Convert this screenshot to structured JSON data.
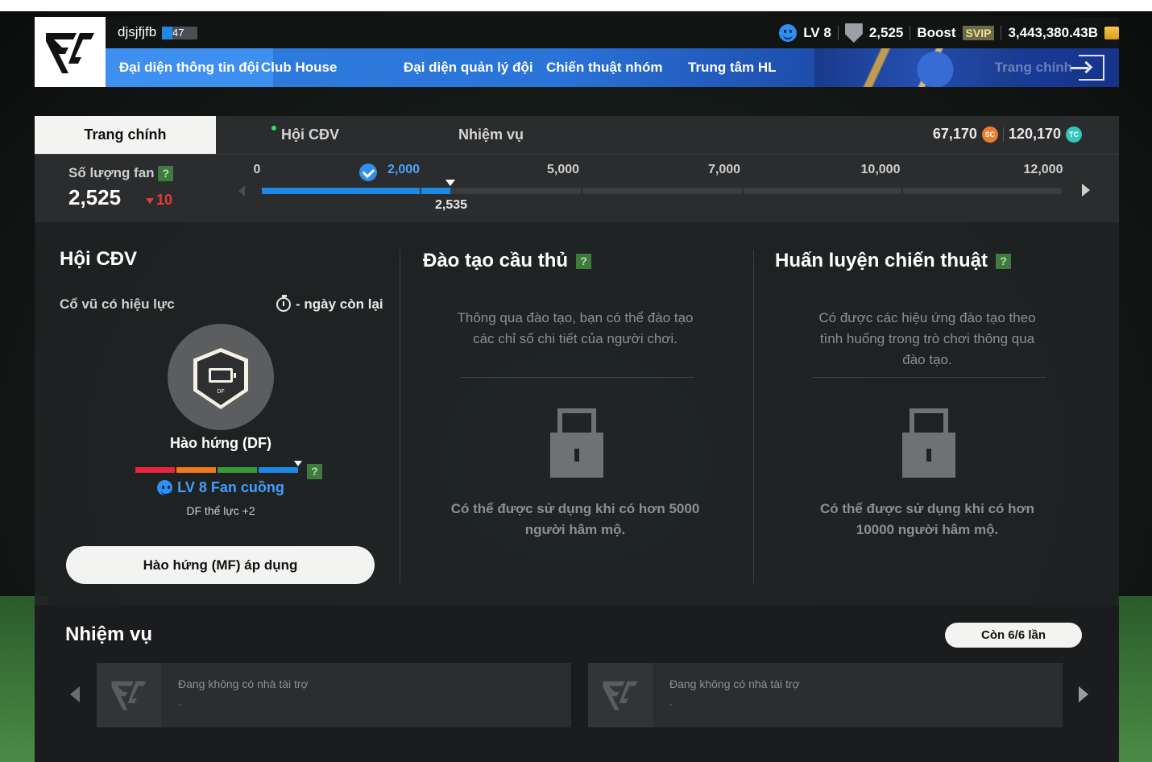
{
  "header": {
    "username": "djsjfjfb",
    "player_level": "47",
    "fan_level": "LV 8",
    "fans": "2,525",
    "boost_label": "Boost",
    "svip_label": "SVIP",
    "balance": "3,443,380.43B"
  },
  "nav": {
    "items": [
      "Đại diện thông tin đội",
      "Club House",
      "Đại diện quản lý đội",
      "Chiến thuật nhóm",
      "Trung tâm HL"
    ],
    "home": "Trang chính"
  },
  "tabs": {
    "items": [
      "Trang chính",
      "Hội CĐV",
      "Nhiệm vụ"
    ],
    "sc_amount": "67,170",
    "tc_amount": "120,170",
    "sc_symbol": "SC",
    "tc_symbol": "TC"
  },
  "fanbar": {
    "label": "Số lượng fan",
    "count": "2,525",
    "delta": "10",
    "ticks": [
      "0",
      "2,000",
      "5,000",
      "7,000",
      "10,000",
      "12,000"
    ],
    "current": "2,535",
    "help": "?"
  },
  "supporters": {
    "title": "Hội CĐV",
    "support_label": "Cổ vũ có hiệu lực",
    "days_left": "- ngày còn lại",
    "badge_pos": "DF",
    "mood_name": "Hào hứng (DF)",
    "mood_colors": [
      "#e8243c",
      "#f07a1a",
      "#3a9a3a",
      "#1e88e5"
    ],
    "fan_level": "LV 8 Fan cuồng",
    "bonus": "DF thể lực +2",
    "apply_button": "Hào hứng (MF) áp dụng"
  },
  "training": {
    "title": "Đào tạo cầu thủ",
    "desc_line1": "Thông qua đào tạo, bạn có thể đào tạo",
    "desc_line2": "các chỉ số chi tiết của người chơi.",
    "locked_line1": "Có thể được sử dụng khi có hơn 5000",
    "locked_line2": "người hâm mộ."
  },
  "tactics": {
    "title": "Huấn luyện chiến thuật",
    "desc_line1": "Có được các hiệu ứng đào tạo theo",
    "desc_line2": "tình huống trong trò chơi thông qua",
    "desc_line3": "đào tạo.",
    "locked_line1": "Có thể được sử dụng khi có hơn",
    "locked_line2": "10000 người hâm mộ."
  },
  "missions": {
    "title": "Nhiệm vụ",
    "remaining": "Còn 6/6 lần",
    "cards": [
      {
        "text": "Đang không có nhà tài trợ",
        "sub": "-"
      },
      {
        "text": "Đang không có nhà tài trợ",
        "sub": "-"
      }
    ]
  }
}
